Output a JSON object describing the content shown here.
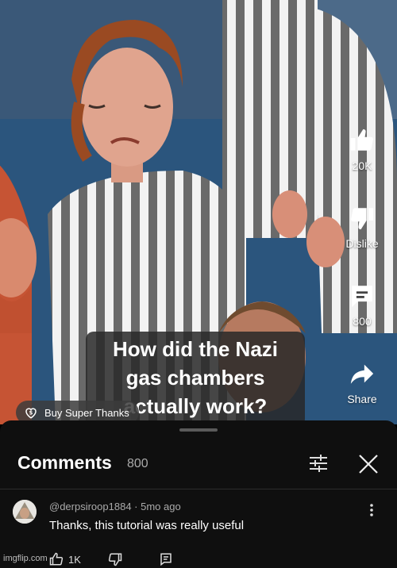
{
  "video": {
    "caption_lines": [
      "How did the Nazi",
      "gas chambers",
      "actually work?"
    ],
    "like_count": "20K",
    "dislike_label": "Dislike",
    "comment_count": "800",
    "share_label": "Share",
    "super_thanks_label": "Buy Super Thanks"
  },
  "comments_panel": {
    "title": "Comments",
    "count": "800",
    "comments": [
      {
        "author": "@derpsiroop1884",
        "time": "5mo ago",
        "text": "Thanks, this tutorial was really useful",
        "likes": "1K"
      }
    ]
  },
  "watermark": "imgflip.com",
  "colors": {
    "background": "#0f0f0f",
    "text": "#ffffff",
    "muted": "#aaaaaa"
  }
}
